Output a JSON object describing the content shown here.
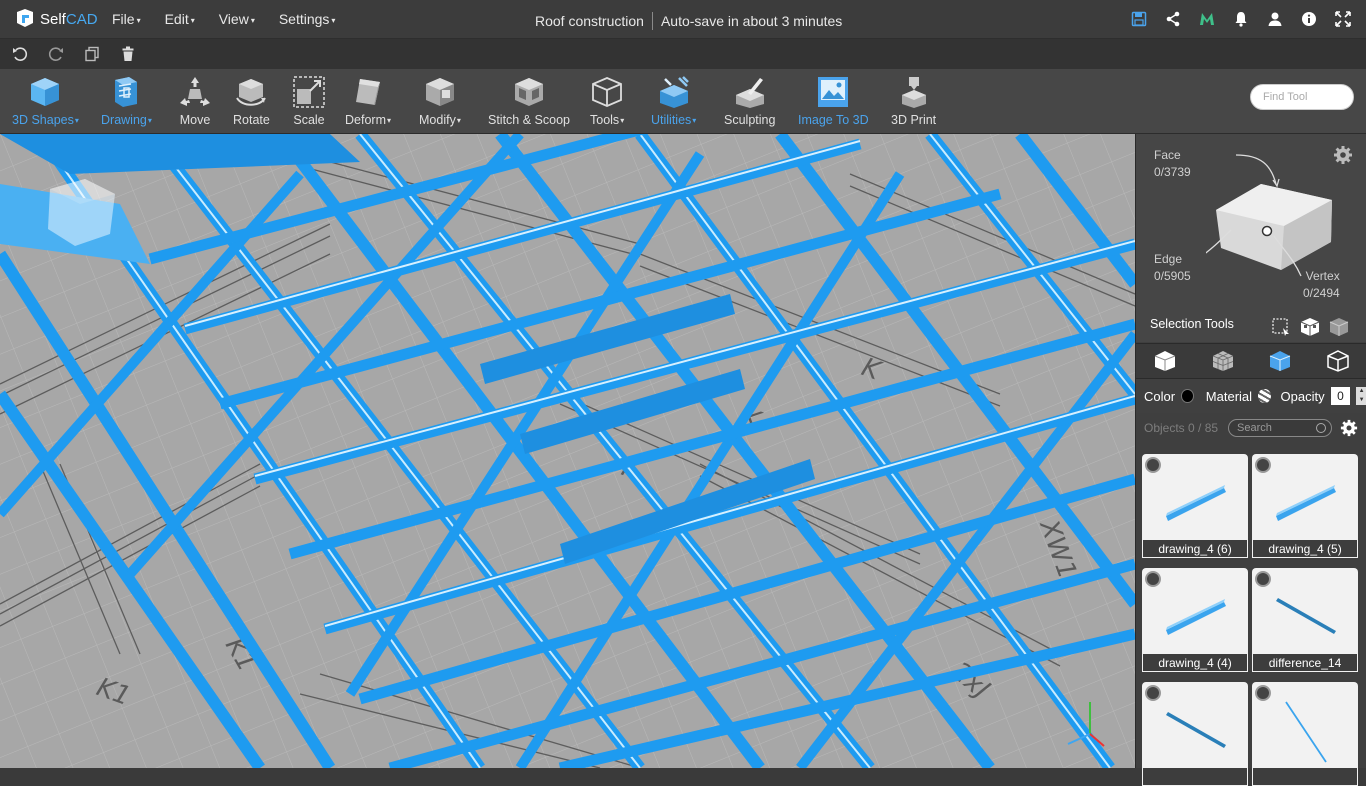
{
  "app": {
    "name_self": "Self",
    "name_cad": "CAD"
  },
  "menu": [
    "File",
    "Edit",
    "View",
    "Settings"
  ],
  "project": {
    "title": "Roof construction",
    "autosave": "Auto-save in about 3 minutes"
  },
  "toolbar": {
    "tools": [
      {
        "label": "3D Shapes",
        "icon": "cube-icon"
      },
      {
        "label": "Drawing",
        "icon": "drawing-icon"
      },
      {
        "label": "Move",
        "icon": "move-icon"
      },
      {
        "label": "Rotate",
        "icon": "rotate-icon"
      },
      {
        "label": "Scale",
        "icon": "scale-icon"
      },
      {
        "label": "Deform",
        "icon": "deform-icon"
      },
      {
        "label": "Modify",
        "icon": "modify-icon"
      },
      {
        "label": "Stitch & Scoop",
        "icon": "stitch-scoop-icon"
      },
      {
        "label": "Tools",
        "icon": "tools-icon"
      },
      {
        "label": "Utilities",
        "icon": "utilities-icon"
      },
      {
        "label": "Sculpting",
        "icon": "sculpting-icon"
      },
      {
        "label": "Image To 3D",
        "icon": "image-to-3d-icon"
      },
      {
        "label": "3D Print",
        "icon": "3d-print-icon"
      }
    ],
    "find_placeholder": "Find Tool"
  },
  "selection": {
    "face_label": "Face",
    "face_count": "0/3739",
    "edge_label": "Edge",
    "edge_count": "0/5905",
    "vertex_label": "Vertex",
    "vertex_count": "0/2494",
    "tools_label": "Selection Tools"
  },
  "properties": {
    "color_label": "Color",
    "color_value": "#000000",
    "material_label": "Material",
    "opacity_label": "Opacity",
    "opacity_value": "0"
  },
  "objects": {
    "count": "Objects 0 / 85",
    "search_placeholder": "Search",
    "items": [
      {
        "name": "drawing_4 (6)"
      },
      {
        "name": "drawing_4 (5)"
      },
      {
        "name": "drawing_4 (4)"
      },
      {
        "name": "difference_14"
      },
      {
        "name": ""
      },
      {
        "name": ""
      }
    ]
  },
  "colors": {
    "accent": "#3ea6f0",
    "beam": "#1e9bf0",
    "toolbar": "#474747",
    "viewport_bg": "#a9a9a9"
  }
}
